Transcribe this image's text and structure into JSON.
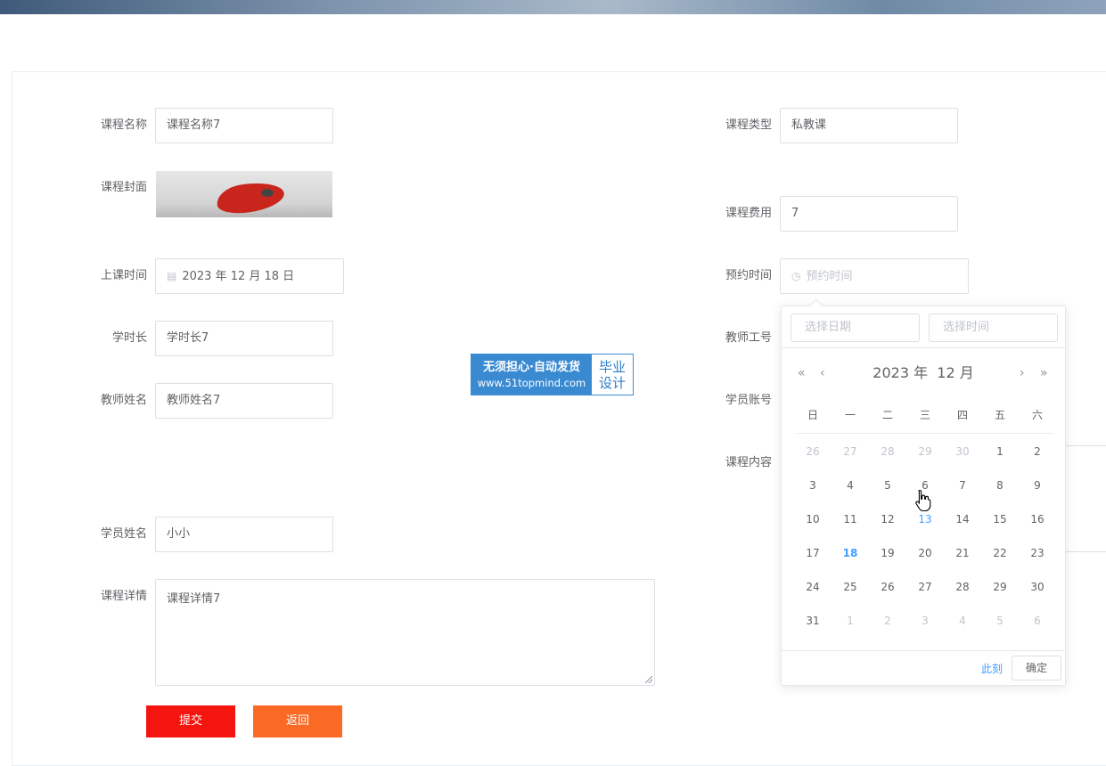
{
  "form": {
    "course_name_label": "课程名称",
    "course_name_value": "课程名称7",
    "course_type_label": "课程类型",
    "course_type_value": "私教课",
    "cover_label": "课程封面",
    "fee_label": "课程费用",
    "fee_value": "7",
    "class_time_label": "上课时间",
    "class_time_value": "2023 年 12 月 18 日",
    "reserve_time_label": "预约时间",
    "reserve_time_placeholder": "预约时间",
    "duration_label": "学时长",
    "duration_value": "学时长7",
    "teacher_id_label": "教师工号",
    "teacher_name_label": "教师姓名",
    "teacher_name_value": "教师姓名7",
    "student_account_label": "学员账号",
    "course_content_label": "课程内容",
    "student_name_label": "学员姓名",
    "student_name_value": "小小",
    "details_label": "课程详情",
    "details_value": "课程详情7",
    "submit_label": "提交",
    "back_label": "返回"
  },
  "watermark": {
    "line1": "无须担心·自动发货",
    "line2": "www.51topmind.com",
    "right1": "毕业",
    "right2": "设计"
  },
  "picker": {
    "date_placeholder": "选择日期",
    "time_placeholder": "选择时间",
    "year": "2023 年",
    "month": "12 月",
    "prev_year": "«",
    "prev_month": "‹",
    "next_month": "›",
    "next_year": "»",
    "weekdays": [
      "日",
      "一",
      "二",
      "三",
      "四",
      "五",
      "六"
    ],
    "days": [
      [
        "26",
        "27",
        "28",
        "29",
        "30",
        "1",
        "2"
      ],
      [
        "3",
        "4",
        "5",
        "6",
        "7",
        "8",
        "9"
      ],
      [
        "10",
        "11",
        "12",
        "13",
        "14",
        "15",
        "16"
      ],
      [
        "17",
        "18",
        "19",
        "20",
        "21",
        "22",
        "23"
      ],
      [
        "24",
        "25",
        "26",
        "27",
        "28",
        "29",
        "30"
      ],
      [
        "31",
        "1",
        "2",
        "3",
        "4",
        "5",
        "6"
      ]
    ],
    "now_label": "此刻",
    "confirm_label": "确定"
  },
  "colors": {
    "submit": "#f5150f",
    "back": "#fb6a25",
    "accent": "#409eff"
  }
}
